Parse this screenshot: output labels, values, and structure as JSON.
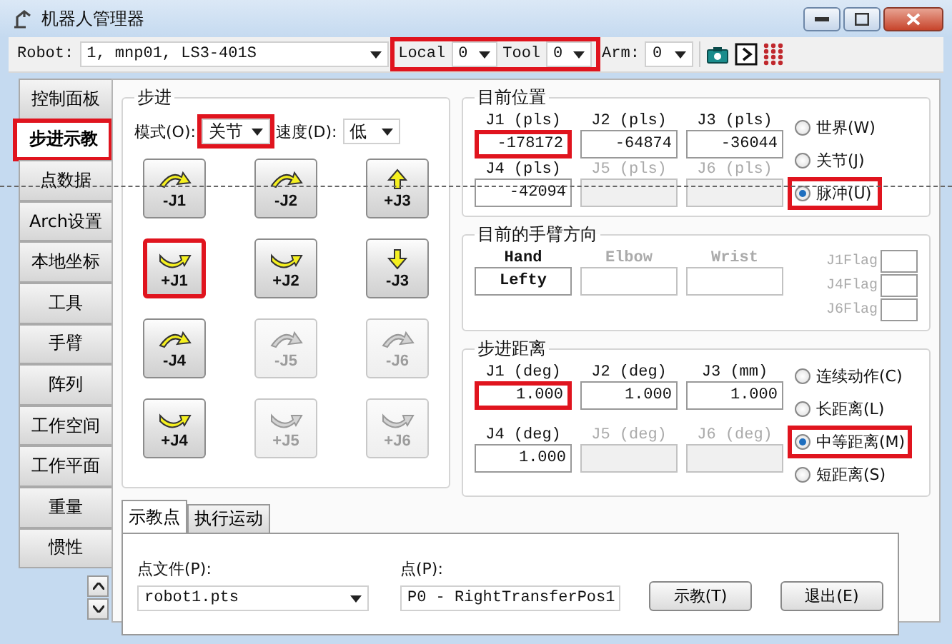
{
  "window": {
    "title": "机器人管理器"
  },
  "toolbar": {
    "robot_label": "Robot:",
    "robot_value": "1, mnp01, LS3-401S",
    "local_label": "Local",
    "local_value": "0",
    "tool_label": "Tool",
    "tool_value": "0",
    "local_tool_highlighted": true,
    "arm_label": "Arm:",
    "arm_value": "0"
  },
  "side_tabs": [
    {
      "label": "控制面板",
      "selected": false,
      "highlighted": false
    },
    {
      "label": "步进示教",
      "selected": true,
      "highlighted": true
    },
    {
      "label": "点数据",
      "selected": false,
      "highlighted": false
    },
    {
      "label": "Arch设置",
      "selected": false,
      "highlighted": false
    },
    {
      "label": "本地坐标",
      "selected": false,
      "highlighted": false
    },
    {
      "label": "工具",
      "selected": false,
      "highlighted": false
    },
    {
      "label": "手臂",
      "selected": false,
      "highlighted": false
    },
    {
      "label": "阵列",
      "selected": false,
      "highlighted": false
    },
    {
      "label": "工作空间",
      "selected": false,
      "highlighted": false
    },
    {
      "label": "工作平面",
      "selected": false,
      "highlighted": false
    },
    {
      "label": "重量",
      "selected": false,
      "highlighted": false
    },
    {
      "label": "惯性",
      "selected": false,
      "highlighted": false
    }
  ],
  "jog": {
    "title": "步进",
    "mode_label": "模式(O):",
    "mode_value": "关节",
    "mode_highlighted": true,
    "speed_label": "速度(D):",
    "speed_value": "低",
    "buttons": [
      {
        "label": "-J1",
        "kind": "arc_over",
        "enabled": true,
        "highlighted": false
      },
      {
        "label": "-J2",
        "kind": "arc_over",
        "enabled": true,
        "highlighted": false
      },
      {
        "label": "+J3",
        "kind": "up",
        "enabled": true,
        "highlighted": false
      },
      {
        "label": "+J1",
        "kind": "arc_under",
        "enabled": true,
        "highlighted": true
      },
      {
        "label": "+J2",
        "kind": "arc_under",
        "enabled": true,
        "highlighted": false
      },
      {
        "label": "-J3",
        "kind": "down",
        "enabled": true,
        "highlighted": false
      },
      {
        "label": "-J4",
        "kind": "arc_over",
        "enabled": true,
        "highlighted": false
      },
      {
        "label": "-J5",
        "kind": "arc_over",
        "enabled": false,
        "highlighted": false
      },
      {
        "label": "-J6",
        "kind": "arc_over",
        "enabled": false,
        "highlighted": false
      },
      {
        "label": "+J4",
        "kind": "arc_under",
        "enabled": true,
        "highlighted": false
      },
      {
        "label": "+J5",
        "kind": "arc_under",
        "enabled": false,
        "highlighted": false
      },
      {
        "label": "+J6",
        "kind": "arc_under",
        "enabled": false,
        "highlighted": false
      }
    ]
  },
  "current_position": {
    "title": "目前位置",
    "fields": [
      {
        "label": "J1 (pls)",
        "value": "-178172",
        "enabled": true,
        "highlighted": true
      },
      {
        "label": "J2 (pls)",
        "value": "-64874",
        "enabled": true,
        "highlighted": false
      },
      {
        "label": "J3 (pls)",
        "value": "-36044",
        "enabled": true,
        "highlighted": false
      },
      {
        "label": "J4 (pls)",
        "value": "-42094",
        "enabled": true,
        "highlighted": false
      },
      {
        "label": "J5 (pls)",
        "enabled": false,
        "highlighted": false
      },
      {
        "label": "J6 (pls)",
        "enabled": false,
        "highlighted": false
      }
    ],
    "options": [
      {
        "label": "世界(W)",
        "selected": false,
        "highlighted": false
      },
      {
        "label": "关节(J)",
        "selected": false,
        "highlighted": false
      },
      {
        "label": "脉冲(U)",
        "selected": true,
        "highlighted": true
      }
    ]
  },
  "arm_orientation": {
    "title": "目前的手臂方向",
    "fields": [
      {
        "label": "Hand",
        "value": "Lefty",
        "enabled": true
      },
      {
        "label": "Elbow",
        "enabled": false
      },
      {
        "label": "Wrist",
        "enabled": false
      }
    ],
    "flags": [
      {
        "label": "J1Flag",
        "enabled": false
      },
      {
        "label": "J4Flag",
        "enabled": false
      },
      {
        "label": "J6Flag",
        "enabled": false
      }
    ]
  },
  "step_distance": {
    "title": "步进距离",
    "fields": [
      {
        "label": "J1 (deg)",
        "value": "1.000",
        "enabled": true,
        "highlighted": true
      },
      {
        "label": "J2 (deg)",
        "value": "1.000",
        "enabled": true,
        "highlighted": false
      },
      {
        "label": "J3 (mm)",
        "value": "1.000",
        "enabled": true,
        "highlighted": false
      },
      {
        "label": "J4 (deg)",
        "value": "1.000",
        "enabled": true,
        "highlighted": false
      },
      {
        "label": "J5 (deg)",
        "enabled": false,
        "highlighted": false
      },
      {
        "label": "J6 (deg)",
        "enabled": false,
        "highlighted": false
      }
    ],
    "options": [
      {
        "label": "连续动作(C)",
        "selected": false,
        "highlighted": false
      },
      {
        "label": "长距离(L)",
        "selected": false,
        "highlighted": false
      },
      {
        "label": "中等距离(M)",
        "selected": true,
        "highlighted": true
      },
      {
        "label": "短距离(S)",
        "selected": false,
        "highlighted": false
      }
    ]
  },
  "bottom": {
    "tabs": [
      {
        "label": "示教点",
        "selected": true
      },
      {
        "label": "执行运动",
        "selected": false
      }
    ],
    "point_file_label": "点文件(P):",
    "point_file_value": "robot1.pts",
    "point_label": "点(P):",
    "point_value": "P0 - RightTransferPos1",
    "buttons": [
      "示教(T)",
      "退出(E)"
    ]
  }
}
